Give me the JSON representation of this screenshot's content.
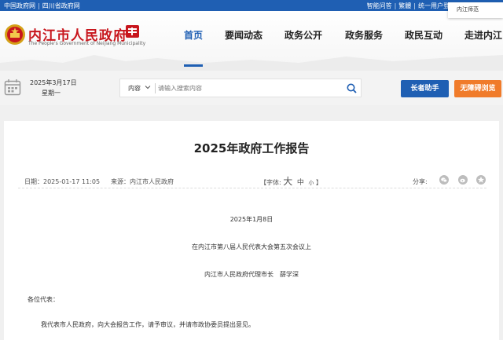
{
  "topbar": {
    "left_links": [
      "中国政府网",
      "四川省政府网"
    ],
    "right_links": [
      "智能问答",
      "繁體",
      "统一用户登"
    ]
  },
  "popup": {
    "text": "内江师范"
  },
  "header": {
    "site_title": "内江市人民政府",
    "site_subtitle": "The People's Government of Neijiang Municipality"
  },
  "nav": {
    "items": [
      "首页",
      "要闻动态",
      "政务公开",
      "政务服务",
      "政民互动",
      "走进内江"
    ],
    "active": "首页"
  },
  "info": {
    "date": "2025年3月17日",
    "weekday": "星期一"
  },
  "search": {
    "scope": "内容",
    "placeholder": "请输入搜索内容"
  },
  "buttons": {
    "elder": "长者助手",
    "accessible": "无障碍浏览"
  },
  "article": {
    "title": "2025年政府工作报告",
    "date": "日期：2025-01-17 11:05",
    "source": "来源：内江市人民政府",
    "font_label": "【字体:",
    "font_large": "大",
    "font_medium": "中",
    "font_small": "小",
    "font_close": "】",
    "share_label": "分享:",
    "report_date": "2025年1月8日",
    "meeting": "在内江市第八届人民代表大会第五次会议上",
    "speaker": "内江市人民政府代理市长　薛学深",
    "salutation": "各位代表：",
    "first_para": "我代表市人民政府，向大会报告工作，请予审议，并请市政协委员提出意见。"
  },
  "colors": {
    "brand_blue": "#1f5fb3",
    "brand_red": "#c8161d",
    "accent_orange": "#f07b2a"
  }
}
